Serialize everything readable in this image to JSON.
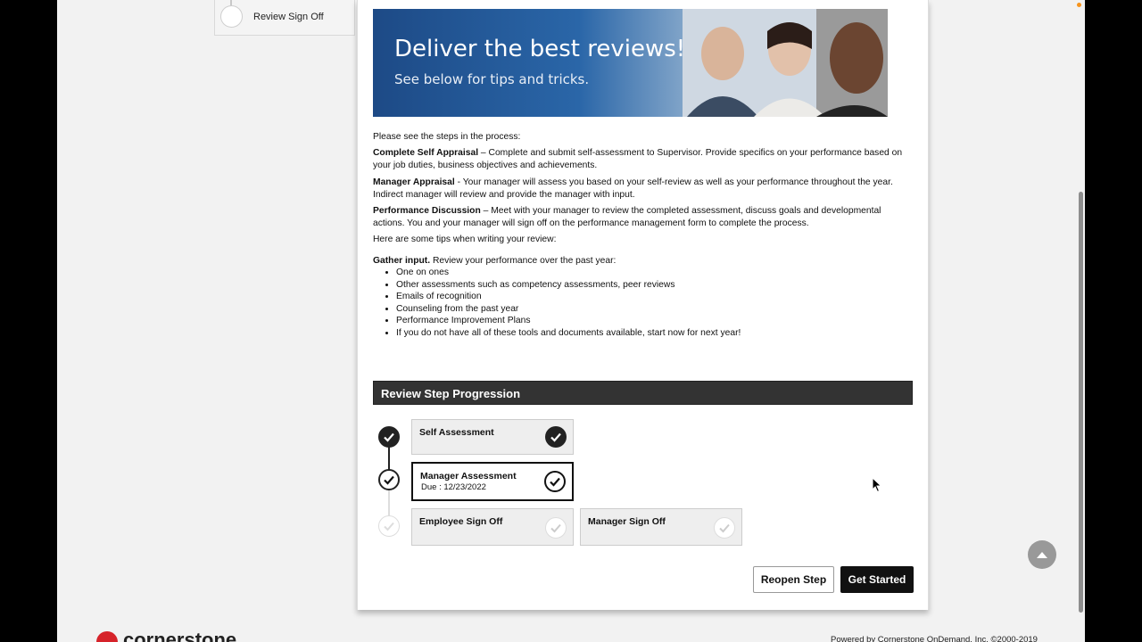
{
  "sidebar": {
    "current_step": {
      "label": "Review Sign Off"
    }
  },
  "banner": {
    "headline": "Deliver the best reviews!",
    "subline": "See below for tips and tricks."
  },
  "intro": {
    "lead": "Please see the steps in the process:",
    "steps": [
      {
        "name": "Complete Self Appraisal",
        "sep": " – ",
        "text": "Complete and submit self-assessment to Supervisor. Provide specifics on your performance based on your job duties, business objectives and achievements."
      },
      {
        "name": "Manager Appraisal",
        "sep": " - ",
        "text": "Your manager will assess you based on your self-review as well as your performance throughout the year. Indirect manager will review and provide the manager with input."
      },
      {
        "name": "Performance Discussion",
        "sep": " – ",
        "text": "Meet with your manager to review the completed assessment, discuss goals and developmental actions. You and your manager will sign off on the performance management form to complete the process."
      }
    ],
    "tips_lead": "Here are some tips when writing your review:",
    "gather_title": "Gather input.",
    "gather_text": " Review your performance over the past year:",
    "tips": [
      "One on ones",
      "Other assessments such as competency assessments, peer reviews",
      "Emails of recognition",
      "Counseling from the past year",
      "Performance Improvement Plans",
      "If you do not have all of these tools and documents available, start now for next year!"
    ]
  },
  "progression": {
    "header": "Review Step Progression",
    "steps": [
      {
        "title": "Self Assessment",
        "status": "completed"
      },
      {
        "title": "Manager Assessment",
        "due": "Due :  12/23/2022",
        "status": "current-completed"
      },
      {
        "title": "Employee Sign Off",
        "status": "pending"
      },
      {
        "title": "Manager Sign Off",
        "status": "pending"
      }
    ]
  },
  "actions": {
    "reopen_label": "Reopen Step",
    "start_label": "Get Started"
  },
  "footer": {
    "logo_text": "cornerstone",
    "powered_by": "Powered by Cornerstone OnDemand, Inc. ©2000-2019"
  },
  "colors": {
    "header_bg": "#333333",
    "primary_button": "#111111",
    "logo_red": "#d6232a",
    "banner_blue": "#1d4a86"
  }
}
